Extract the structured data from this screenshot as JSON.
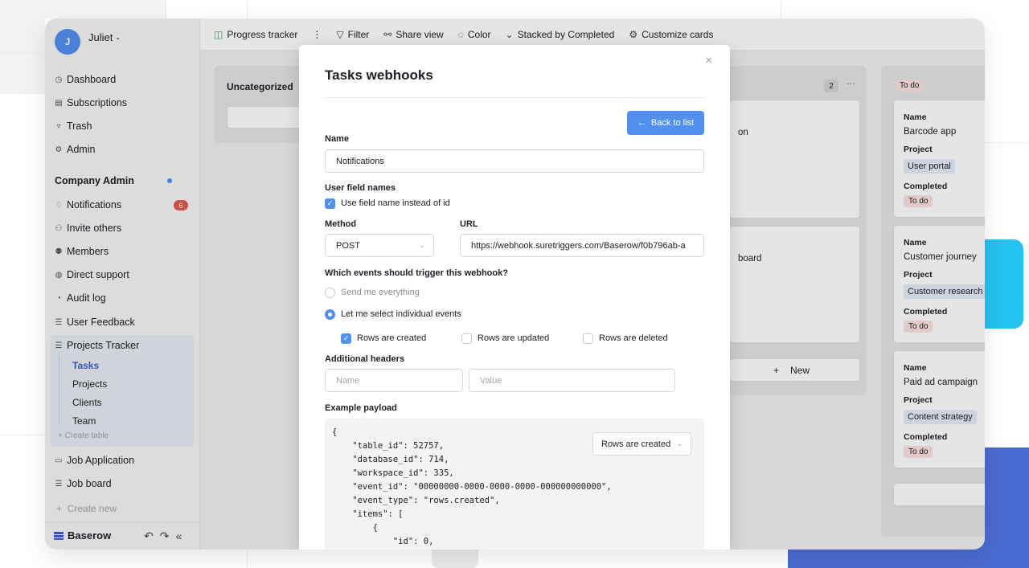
{
  "user": {
    "initial": "J",
    "name": "Juliet"
  },
  "sidebar": {
    "top_items": [
      {
        "label": "Dashboard",
        "icon": "dashboard-icon"
      },
      {
        "label": "Subscriptions",
        "icon": "subscriptions-icon"
      },
      {
        "label": "Trash",
        "icon": "trash-icon"
      },
      {
        "label": "Admin",
        "icon": "gear-icon"
      }
    ],
    "workspace_title": "Company Admin",
    "workspace_items": [
      {
        "label": "Notifications",
        "icon": "bell-icon",
        "badge": "6"
      },
      {
        "label": "Invite others",
        "icon": "invite-icon"
      },
      {
        "label": "Members",
        "icon": "members-icon"
      },
      {
        "label": "Direct support",
        "icon": "support-icon"
      },
      {
        "label": "Audit log",
        "icon": "audit-icon"
      },
      {
        "label": "User Feedback",
        "icon": "database-icon"
      },
      {
        "label": "Projects Tracker",
        "icon": "database-icon"
      }
    ],
    "tables": [
      "Tasks",
      "Projects",
      "Clients",
      "Team"
    ],
    "active_table": "Tasks",
    "create_table": "+ Create table",
    "other_items": [
      {
        "label": "Job Application",
        "icon": "application-icon"
      },
      {
        "label": "Job board",
        "icon": "database-icon"
      }
    ],
    "create_new": "Create new",
    "brand": "Baserow"
  },
  "header": {
    "view_name": "Progress tracker",
    "filter": "Filter",
    "share_view": "Share view",
    "color": "Color",
    "stacked_by": "Stacked by Completed",
    "customize_cards": "Customize cards"
  },
  "board": {
    "uncategorized": "Uncategorized",
    "middle_count": "2",
    "middle_fragments": [
      "on",
      "board"
    ],
    "new_label": "New",
    "todo_stack": "To do",
    "card_labels": {
      "name": "Name",
      "project": "Project",
      "completed": "Completed"
    },
    "cards": [
      {
        "name": "Barcode app",
        "project": "User portal",
        "completed": "To do"
      },
      {
        "name": "Customer journey",
        "project": "Customer research",
        "completed": "To do"
      },
      {
        "name": "Paid ad campaign",
        "project": "Content strategy",
        "completed": "To do"
      }
    ]
  },
  "modal": {
    "title": "Tasks webhooks",
    "back_label": "Back to list",
    "name_label": "Name",
    "name_value": "Notifications",
    "user_field_names_label": "User field names",
    "use_field_name": "Use field name instead of id",
    "method_label": "Method",
    "method_value": "POST",
    "url_label": "URL",
    "url_value": "https://webhook.suretriggers.com/Baserow/f0b796ab-a",
    "events_label": "Which events should trigger this webhook?",
    "send_everything": "Send me everything",
    "select_individual": "Let me select individual events",
    "events": [
      {
        "label": "Rows are created",
        "checked": true
      },
      {
        "label": "Rows are updated",
        "checked": false
      },
      {
        "label": "Rows are deleted",
        "checked": false
      }
    ],
    "additional_headers_label": "Additional headers",
    "header_name_placeholder": "Name",
    "header_value_placeholder": "Value",
    "example_payload_label": "Example payload",
    "payload_event_select": "Rows are created",
    "payload_lines": [
      "{",
      "    \"table_id\": 52757,",
      "    \"database_id\": 714,",
      "    \"workspace_id\": 335,",
      "    \"event_id\": \"00000000-0000-0000-0000-000000000000\",",
      "    \"event_type\": \"rows.created\",",
      "    \"items\": [",
      "        {",
      "            \"id\": 0,"
    ]
  },
  "colors": {
    "accent": "#5190ef",
    "badge_red": "#e15a4c",
    "deco_cyan": "#24c3f0",
    "deco_blue": "#4a6bd1"
  }
}
